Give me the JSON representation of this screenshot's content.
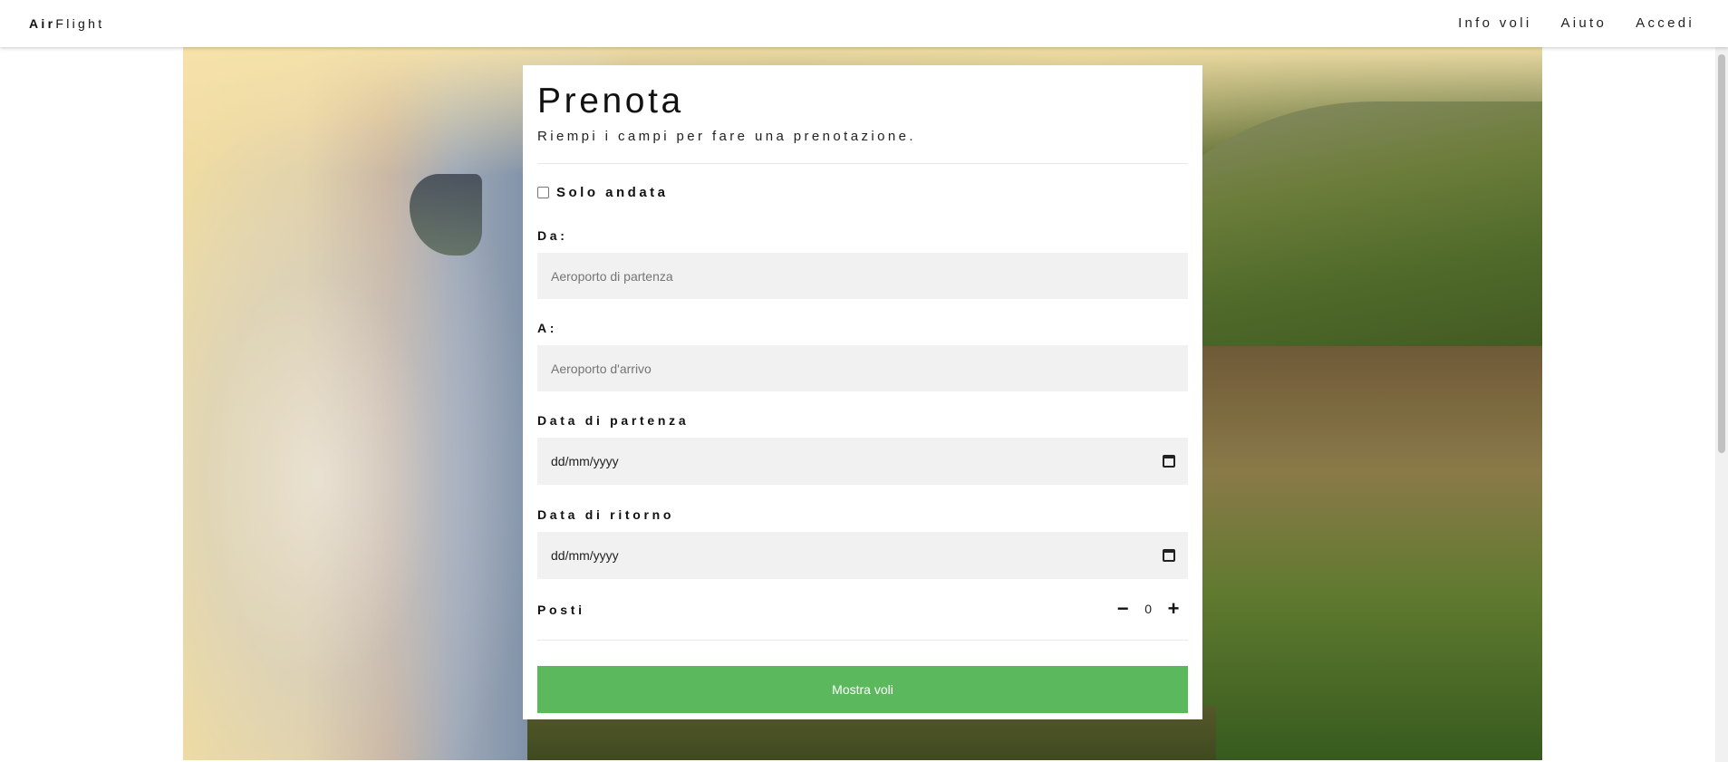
{
  "header": {
    "brand_bold": "Air",
    "brand_rest": "Flight",
    "nav": [
      {
        "label": "Info voli"
      },
      {
        "label": "Aiuto"
      },
      {
        "label": "Accedi"
      }
    ]
  },
  "booking": {
    "title": "Prenota",
    "subtitle": "Riempi i campi per fare una prenotazione.",
    "one_way_label": "Solo andata",
    "one_way_checked": false,
    "from_label": "Da:",
    "from_placeholder": "Aeroporto di partenza",
    "to_label": "A:",
    "to_placeholder": "Aeroporto d'arrivo",
    "departure_label": "Data di partenza",
    "departure_value": "dd/mm/yyyy",
    "return_label": "Data di ritorno",
    "return_value": "dd/mm/yyyy",
    "seats_label": "Posti",
    "seats_minus": "−",
    "seats_value": "0",
    "seats_plus": "+",
    "submit_label": "Mostra voli"
  },
  "icons": {
    "calendar": "calendar-icon",
    "minus": "minus-icon",
    "plus": "plus-icon"
  },
  "colors": {
    "submit_bg": "#5cb85c",
    "field_bg": "#f1f1f1"
  }
}
